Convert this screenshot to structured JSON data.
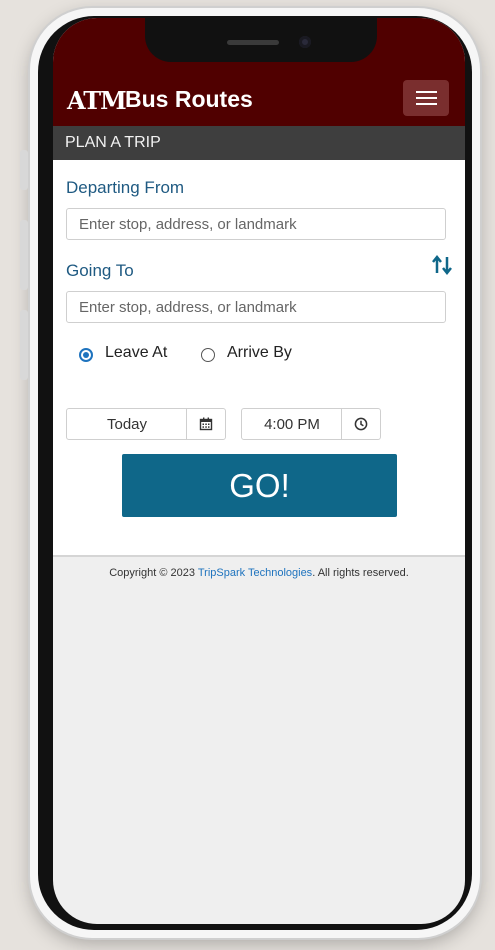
{
  "header": {
    "logo_text": "ATM",
    "title": "Bus Routes",
    "menu_icon": "hamburger-menu-icon"
  },
  "subheader": {
    "title": "PLAN A TRIP"
  },
  "form": {
    "departing_label": "Departing From",
    "departing_placeholder": "Enter stop, address, or landmark",
    "going_label": "Going To",
    "going_placeholder": "Enter stop, address, or landmark",
    "swap_icon": "swap-vertical-arrows-icon",
    "leave_label": "Leave At",
    "arrive_label": "Arrive By",
    "leave_selected": true,
    "date_value": "Today",
    "date_icon": "calendar-icon",
    "time_value": "4:00 PM",
    "time_icon": "clock-icon",
    "go_label": "GO!"
  },
  "footer": {
    "prefix": "Copyright © 2023 ",
    "link": "TripSpark Technologies",
    "suffix": ". All rights reserved."
  },
  "colors": {
    "brand_maroon": "#500000",
    "subbar": "#3e3e3e",
    "label_blue": "#1f5a82",
    "go_button": "#0f6789",
    "link_blue": "#1e73be"
  }
}
